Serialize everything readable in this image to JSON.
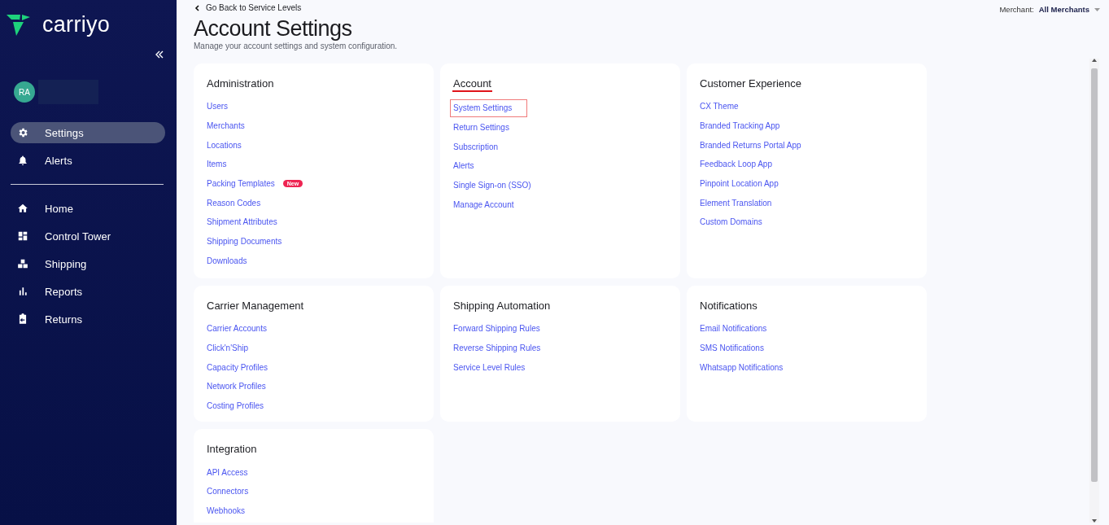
{
  "sidebar": {
    "logo": "carriyo",
    "avatar": "RA",
    "nav_top": [
      {
        "label": "Settings",
        "selected": true
      },
      {
        "label": "Alerts",
        "selected": false
      }
    ],
    "nav_main": [
      {
        "label": "Home",
        "selected": false
      },
      {
        "label": "Control Tower",
        "selected": false
      },
      {
        "label": "Shipping",
        "selected": false
      },
      {
        "label": "Reports",
        "selected": false
      },
      {
        "label": "Returns",
        "selected": false
      }
    ]
  },
  "header": {
    "back_link": "Go Back to Service Levels",
    "title": "Account Settings",
    "subtitle": "Manage your account settings and system configuration.",
    "merchant_filter": {
      "label": "Merchant:",
      "value": "All Merchants"
    }
  },
  "sections": [
    {
      "title": "Administration",
      "underlined": false,
      "links": [
        {
          "label": "Users",
          "highlighted": false
        },
        {
          "label": "Merchants",
          "highlighted": false
        },
        {
          "label": "Locations",
          "highlighted": false
        },
        {
          "label": "Items",
          "highlighted": false
        },
        {
          "label": "Packing Templates",
          "highlighted": false,
          "badge": "New"
        },
        {
          "label": "Reason Codes",
          "highlighted": false
        },
        {
          "label": "Shipment Attributes",
          "highlighted": false
        },
        {
          "label": "Shipping Documents",
          "highlighted": false
        },
        {
          "label": "Downloads",
          "highlighted": false
        }
      ]
    },
    {
      "title": "Account",
      "underlined": true,
      "links": [
        {
          "label": "System Settings",
          "highlighted": true
        },
        {
          "label": "Return Settings",
          "highlighted": false
        },
        {
          "label": "Subscription",
          "highlighted": false
        },
        {
          "label": "Alerts",
          "highlighted": false
        },
        {
          "label": "Single Sign-on (SSO)",
          "highlighted": false
        },
        {
          "label": "Manage Account",
          "highlighted": false
        }
      ]
    },
    {
      "title": "Customer Experience",
      "underlined": false,
      "links": [
        {
          "label": "CX Theme",
          "highlighted": false
        },
        {
          "label": "Branded Tracking App",
          "highlighted": false
        },
        {
          "label": "Branded Returns Portal App",
          "highlighted": false
        },
        {
          "label": "Feedback Loop App",
          "highlighted": false
        },
        {
          "label": "Pinpoint Location App",
          "highlighted": false
        },
        {
          "label": "Element Translation",
          "highlighted": false
        },
        {
          "label": "Custom Domains",
          "highlighted": false
        }
      ]
    },
    {
      "title": "Carrier Management",
      "underlined": false,
      "links": [
        {
          "label": "Carrier Accounts",
          "highlighted": false
        },
        {
          "label": "Click'n'Ship",
          "highlighted": false
        },
        {
          "label": "Capacity Profiles",
          "highlighted": false
        },
        {
          "label": "Network Profiles",
          "highlighted": false
        },
        {
          "label": "Costing Profiles",
          "highlighted": false
        }
      ]
    },
    {
      "title": "Shipping Automation",
      "underlined": false,
      "links": [
        {
          "label": "Forward Shipping Rules",
          "highlighted": false
        },
        {
          "label": "Reverse Shipping Rules",
          "highlighted": false
        },
        {
          "label": "Service Level Rules",
          "highlighted": false
        }
      ]
    },
    {
      "title": "Notifications",
      "underlined": false,
      "links": [
        {
          "label": "Email Notifications",
          "highlighted": false
        },
        {
          "label": "SMS Notifications",
          "highlighted": false
        },
        {
          "label": "Whatsapp Notifications",
          "highlighted": false
        }
      ]
    },
    {
      "title": "Integration",
      "underlined": false,
      "links": [
        {
          "label": "API Access",
          "highlighted": false
        },
        {
          "label": "Connectors",
          "highlighted": false
        },
        {
          "label": "Webhooks",
          "highlighted": false
        }
      ]
    }
  ]
}
